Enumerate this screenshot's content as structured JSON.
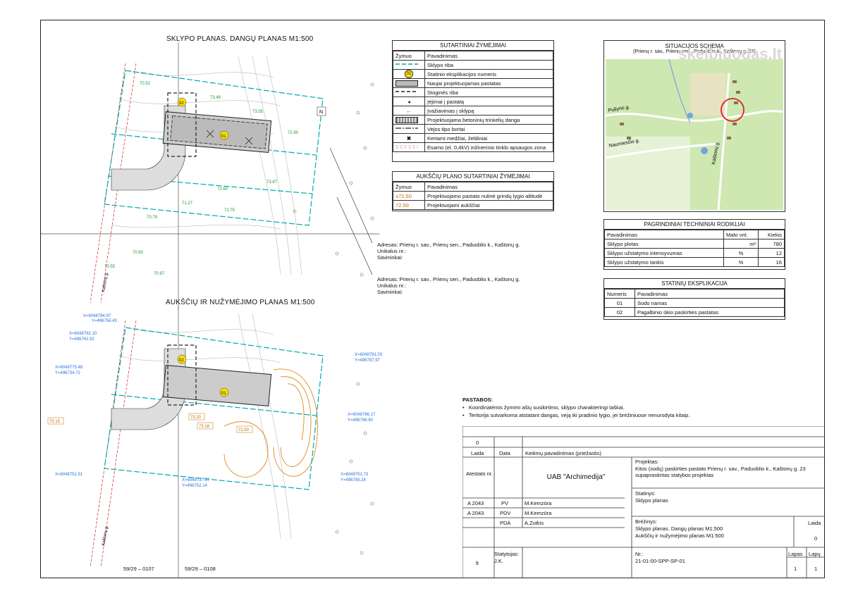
{
  "plan_top": {
    "title": "SKLYPO PLANAS. DANGŲ PLANAS M1:500",
    "address1": [
      "Adresas: Prienų r. sav., Prienų sen., Paduoblio k., Kaštonų g.",
      "Unikalus nr.:",
      "Savininkai:"
    ],
    "address2": [
      "Adresas: Prienų r. sav., Prienų sen., Paduoblio k., Kaštonų g.",
      "Unikalus nr.:",
      "Savininkai:"
    ],
    "labels": [
      "01",
      "02",
      "N",
      "Kaštonų g."
    ]
  },
  "plan_bottom": {
    "title": "AUKŠČIŲ IR NUŽYMĖJIMO PLANAS M1:500",
    "sheet_refs": [
      "59/29 – 0107",
      "59/29 – 0108"
    ],
    "coords": [
      "X=6048784.97",
      "Y=496756.43",
      "X=6048781.03",
      "Y=496787.97",
      "X=6048766.17",
      "Y=496786.90",
      "X=6048751.73",
      "Y=496785.24",
      "X=6048775.48",
      "Y=496734.72",
      "X=6048751.51",
      "X=6048737.37",
      "Y=496752.14",
      "X=6048782.10",
      "Y=496761.92"
    ],
    "levels": [
      "73.20",
      "73.18",
      "72.50",
      "70.15"
    ],
    "labels": [
      "01",
      "02",
      "Kaštonų g."
    ]
  },
  "legend": {
    "title": "SUTARTINIAI ŽYMĖJIMAI",
    "col1": "Žymuo",
    "col2": "Pavadinimas",
    "rows": [
      {
        "symbol": "dash-line",
        "text": "Sklypo riba"
      },
      {
        "symbol": "circle-01",
        "text": "Statinio eksplikacijos numeris",
        "code": "01"
      },
      {
        "symbol": "grey-rect",
        "text": "Naujai projektuojamas pastatas"
      },
      {
        "symbol": "thick-dash",
        "text": "Stoginės riba"
      },
      {
        "symbol": "arrow-small",
        "text": "Įėjimai į pastatą"
      },
      {
        "symbol": "arrow-big",
        "text": "Įvažiavimas į sklypą"
      },
      {
        "symbol": "paving",
        "text": "Projektuojama betoninių trinkelių danga"
      },
      {
        "symbol": "dash-dot",
        "text": "Vejos tipo bortai"
      },
      {
        "symbol": "cross",
        "text": "Kertami medžiai, želdiniai"
      },
      {
        "symbol": "zone-line",
        "text": "Esamo (el. 0,4kV) inžinerinio tinklo apsaugos zona"
      }
    ]
  },
  "height_legend": {
    "title": "AUKŠČIŲ PLANO SUTARTINIAI ŽYMĖJIMAI",
    "col1": "Žymuo",
    "col2": "Pavadinimas",
    "rows": [
      {
        "symbol": "±72.50",
        "text": "Projektuojamo pastato nulinė grindų lygio altitudė"
      },
      {
        "symbol": "72.50",
        "text": "Projektuojami aukščiai"
      }
    ]
  },
  "situation": {
    "title": "SITUACIJOS SCHEMA",
    "subtitle": "(Prienų r. sav., Prienų sen., Paduoblio k., Kaštonų g. 23)",
    "streets": [
      "Pušyno g.",
      "Naumiesčio g.",
      "Kaštonų g."
    ],
    "watermark": "skelbiuodas.lt"
  },
  "indicators": {
    "title": "PAGRINDINIAI TECHNINIAI RODIKLIAI",
    "headers": [
      "Pavadinimas",
      "Mato vnt.",
      "Kiekis"
    ],
    "rows": [
      [
        "Sklypo plotas",
        "m²",
        "780"
      ],
      [
        "Sklypo užstatymo intensyvumas",
        "%",
        "12"
      ],
      [
        "Sklypo užstatymo tankis",
        "%",
        "16"
      ]
    ]
  },
  "explication": {
    "title": "STATINIŲ EKSPLIKACIJA",
    "headers": [
      "Numeris",
      "Pavadinimas"
    ],
    "rows": [
      [
        "01",
        "Sodo namas"
      ],
      [
        "02",
        "Pagalbinio ūkio paskirties pastatas"
      ]
    ]
  },
  "notes": {
    "title": "PASTABOS:",
    "items": [
      "Koordinatėmis žymimi ašių susikirtimo, sklypo charakteringi taškai.",
      "Teritorija sutvarkoma atstatant dangas, veją iki pradinio lygio, jei brėžiniuose nenurodyta kitaip."
    ]
  },
  "title_block": {
    "rev_zero": "0",
    "laida": "Laida",
    "data": "Data",
    "keitimu": "Keitimų pavadinimas (priežastis)",
    "atestato": "Atestato nr.",
    "company": "UAB \"Archimedija\"",
    "projektas_label": "Projektas:",
    "projektas": "Kitos (sodų) paskirties pastato Prienų r. sav., Paduoblio k., Kaštonų g. 23 supaprastintas statybos projektas",
    "statinys_label": "Statinys:",
    "statinys": "Sklypo planas",
    "staff": [
      {
        "atest": "A 2043",
        "role": "PV",
        "name": "M.Kemzūra"
      },
      {
        "atest": "A 2043",
        "role": "PDV",
        "name": "M.Kemzūra"
      },
      {
        "atest": "",
        "role": "PDA",
        "name": "A.Zutkis"
      }
    ],
    "breziniai_label": "Brėžinys:",
    "breziniai": [
      "Sklypo planas. Dangų planas M1:500",
      "Aukščių ir nužymėjimo planas M1:500"
    ],
    "laida2": "Laida",
    "laida2_val": "0",
    "lt": "lt",
    "statytojas_label": "Statytojas:",
    "statytojas": "J.K.",
    "nr_label": "Nr.:",
    "nr": "21-01-00-SPP-SP-01",
    "lapas": "Lapas",
    "lapu": "Lapų",
    "lapas_val": "1",
    "lapu_val": "1"
  }
}
